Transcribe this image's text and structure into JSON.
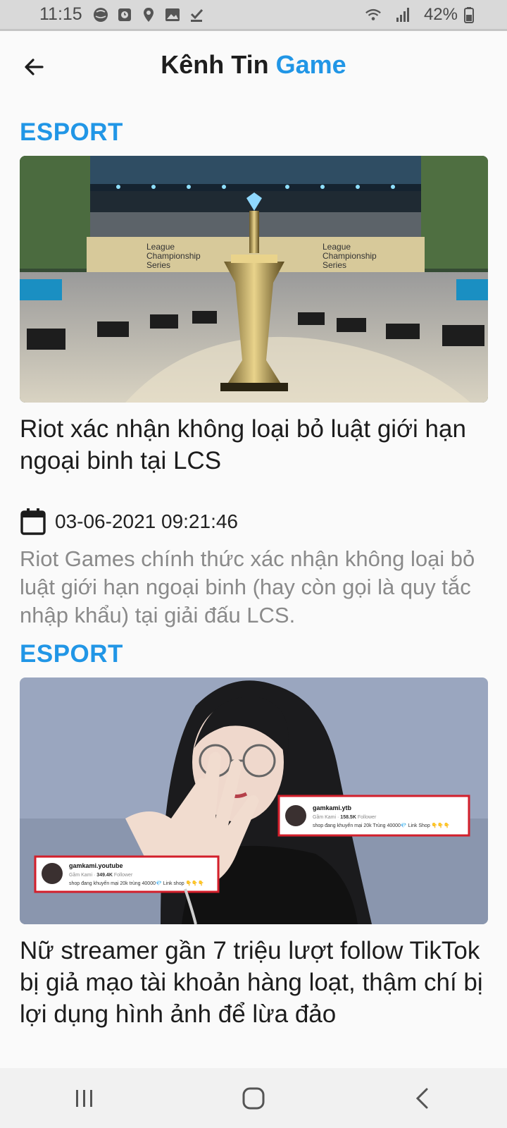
{
  "status_bar": {
    "time": "11:15",
    "battery": "42%",
    "icons": [
      "globe-icon",
      "alarm-icon",
      "location-icon",
      "image-icon",
      "download-done-icon",
      "wifi-icon",
      "signal-icon",
      "battery-icon"
    ]
  },
  "app_bar": {
    "title_main": "Kênh Tin",
    "title_accent": "Game",
    "back_icon": "arrow-left-icon"
  },
  "colors": {
    "accent": "#2196e6",
    "text": "#1c1c1c",
    "muted": "#8a8a8a"
  },
  "articles": [
    {
      "category": "ESPORT",
      "image": "lcs-trophy-stage-photo",
      "image_text": [
        "League",
        "Championship",
        "Series"
      ],
      "title": "Riot xác nhận không loại bỏ luật giới hạn ngoại binh tại LCS",
      "date": "03-06-2021 09:21:46",
      "summary": "Riot Games chính thức xác nhận không loại bỏ luật giới hạn ngoại binh (hay còn gọi là quy tắc nhập khẩu) tại giải đấu LCS."
    },
    {
      "category": "ESPORT",
      "image": "streamer-photo-with-fake-accounts",
      "image_cards": [
        {
          "handle": "gamkami.ytb",
          "name": "Gầm Kami",
          "followers": "158.5K",
          "followers_label": "Follower",
          "bio": "shop đang khuyến mại 20k Trùng 40000💎 Link Shop 👇👇👇"
        },
        {
          "handle": "gamkami.youtube",
          "name": "Gầm Kami",
          "followers": "349.4K",
          "followers_label": "Follower",
          "bio": "shop đang khuyến mại 20k trùng 40000💎 Link shop 👇👇👇"
        }
      ],
      "title": "Nữ streamer gần 7 triệu lượt follow TikTok bị giả mạo tài khoản hàng loạt, thậm chí bị lợi dụng hình ảnh để lừa đảo"
    }
  ],
  "nav_bar": {
    "buttons": [
      "recent-apps-icon",
      "home-icon",
      "back-icon"
    ]
  }
}
